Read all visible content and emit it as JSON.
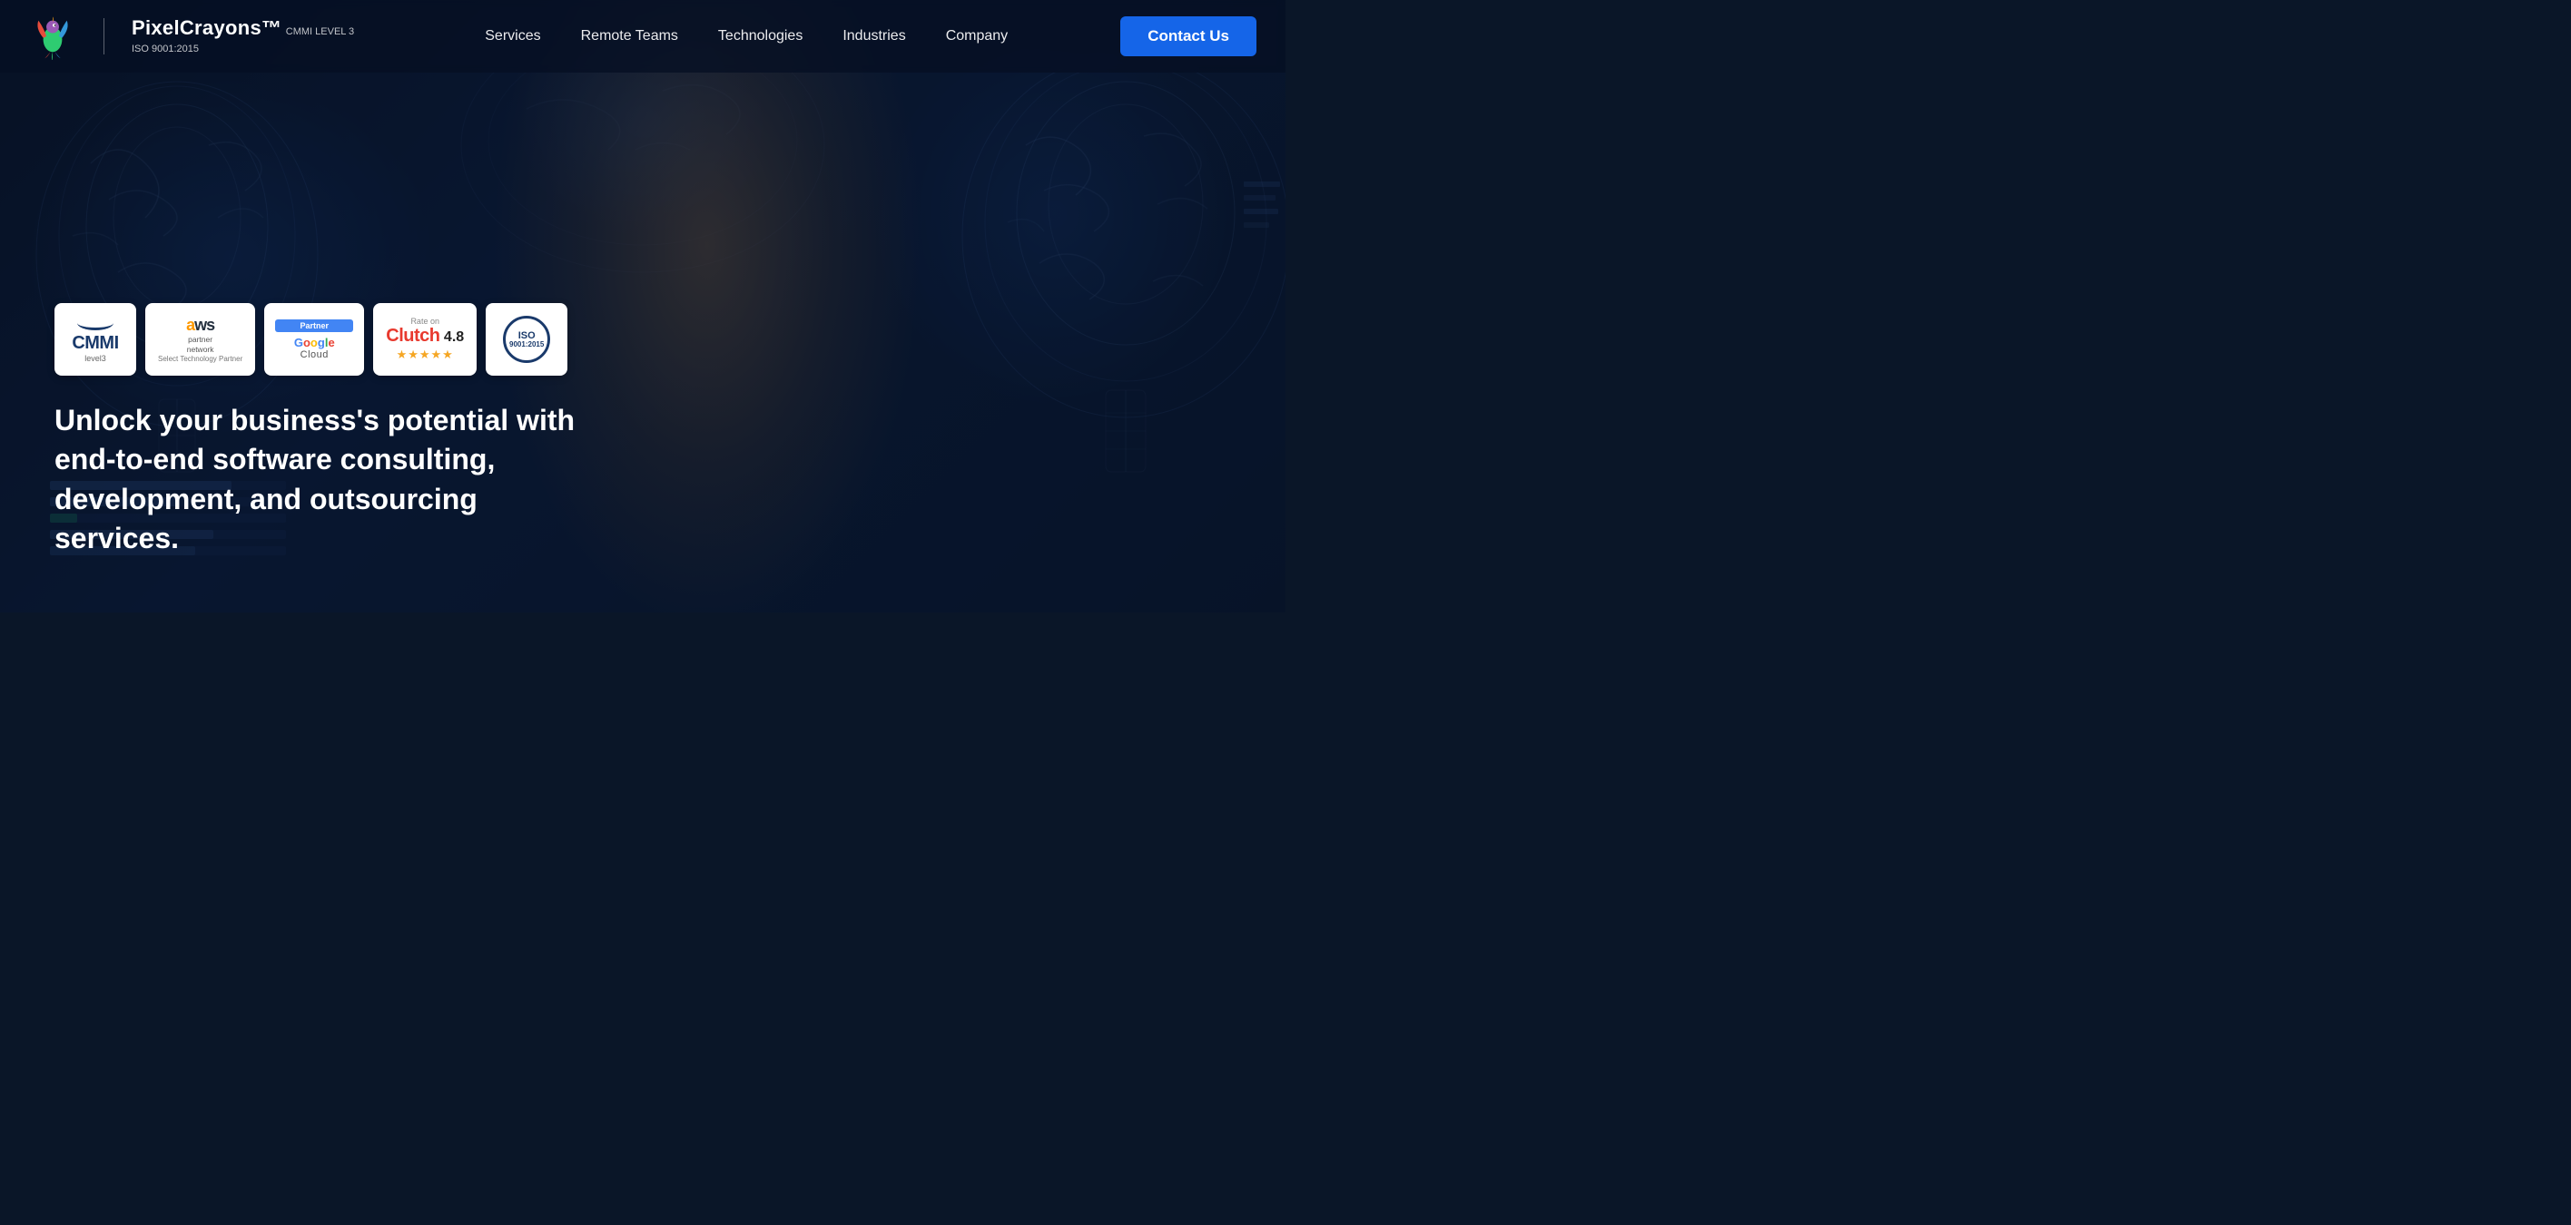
{
  "navbar": {
    "logo_brand": "PixelCrayons™",
    "logo_cert_line1": "CMMI LEVEL 3",
    "logo_cert_line2": "ISO 9001:2015",
    "nav_items": [
      {
        "id": "services",
        "label": "Services"
      },
      {
        "id": "remote-teams",
        "label": "Remote Teams"
      },
      {
        "id": "technologies",
        "label": "Technologies"
      },
      {
        "id": "industries",
        "label": "Industries"
      },
      {
        "id": "company",
        "label": "Company"
      }
    ],
    "contact_btn": "Contact Us"
  },
  "badges": [
    {
      "id": "cmmi",
      "type": "cmmi",
      "label": "CMMI"
    },
    {
      "id": "aws",
      "type": "aws",
      "label": "aws partner network"
    },
    {
      "id": "google-cloud",
      "type": "google-cloud",
      "label": "Google Cloud"
    },
    {
      "id": "clutch",
      "type": "clutch",
      "label": "Clutch",
      "rate_label": "Rate on",
      "score": "4.8"
    },
    {
      "id": "iso",
      "type": "iso",
      "label": "ISO 9001:2015"
    }
  ],
  "hero": {
    "headline": "Unlock your business's potential with end-to-end software consulting, development, and outsourcing services."
  }
}
